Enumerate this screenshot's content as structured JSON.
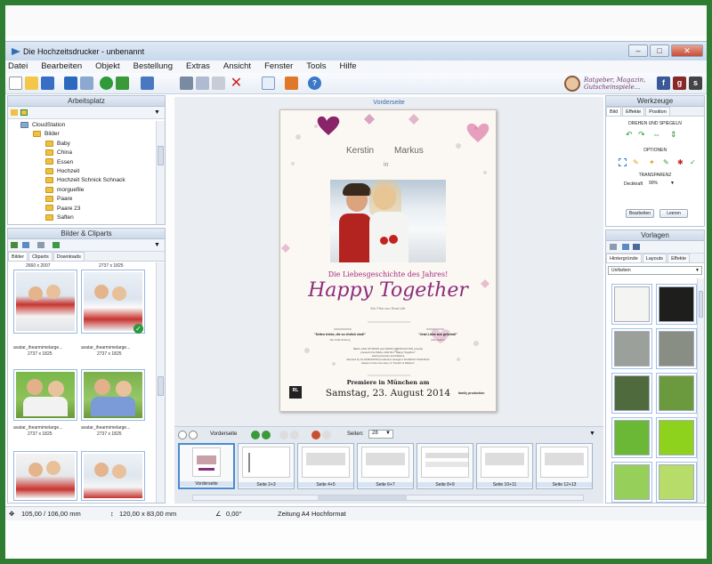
{
  "window": {
    "title": "Die Hochzeitsdrucker - unbenannt"
  },
  "menu": [
    "Datei",
    "Bearbeiten",
    "Objekt",
    "Bestellung",
    "Extras",
    "Ansicht",
    "Fenster",
    "Tools",
    "Hilfe"
  ],
  "brand": {
    "line1": "Ratgeber, Magazin,",
    "line2": "Gutscheinspiele..."
  },
  "workspace": {
    "title": "Arbeitsplatz",
    "tree": [
      "CloudStation",
      "Bilder",
      "Baby",
      "China",
      "Essen",
      "Hochzeit",
      "Hochzeit Schnick Schnack",
      "morguefile",
      "Paare",
      "Paare 23",
      "Saften"
    ]
  },
  "clipart": {
    "title": "Bilder & Cliparts",
    "tabs": [
      "Bilder",
      "Cliparts",
      "Downloads"
    ],
    "thumbs": [
      {
        "top": "2660 x 2007",
        "bottom": "avatar_ihearmimelarge...",
        "dims": "2737 x 1825"
      },
      {
        "top": "2737 x 1825",
        "bottom": "avatar_ihearmimelarge...",
        "dims": "2737 x 1825"
      },
      {
        "bottom": "avatar_ihearmimelarge...",
        "dims": "2737 x 1825"
      },
      {
        "bottom": "avatar_ihearmimelarge...",
        "dims": "2737 x 1825"
      }
    ]
  },
  "canvas": {
    "page_label": "Vorderseite"
  },
  "card": {
    "name1": "Kerstin",
    "name2": "Markus",
    "in": "in",
    "subtitle": "Die Liebesgeschichte des Jahres!",
    "headline": "Happy Together",
    "tagline": "Ein Film von Real Life",
    "quote_left": "\"Selten triebe, die so ehrlich sind!\"",
    "quote_left_src": "Die Kritik Zeitung",
    "quote_right": "\"Jetzt Liebe aus geheimt!\"",
    "quote_right_src": "Das Gefühl",
    "credits1": "REAL LIFE STUDIOS and FAMILY PRODUCTION proudly",
    "credits2": "presents the REAL LIFE film \"Happy Together\"",
    "credits3": "starring Kerstin and Markus",
    "credits4": "directed by ILLUMINATION  production designer SCHNICK SCHNACK",
    "credits5": "based on the true story of \"Kerstin & Markus\"",
    "premiere": "Premiere in München  am",
    "date": "Samstag, 23. August 2014",
    "rl": "RL",
    "family": "family production"
  },
  "pagesbar": {
    "left_label": "Vorderseite",
    "seiten_label": "Seiten:",
    "seiten_value": "28",
    "thumbs": [
      "Vorderseite",
      "Seite 2+3",
      "Seite 4+5",
      "Seite 6+7",
      "Seite 8+9",
      "Seite 10+11",
      "Seite 12+13"
    ]
  },
  "tools": {
    "title": "Werkzeuge",
    "tabs": [
      "Bild",
      "Effekte",
      "Position"
    ],
    "rotate_label": "DREHEN UND SPIEGELN",
    "options_label": "OPTIONEN",
    "transparency_label": "TRANSPARENZ",
    "transparency_field": "Deckkraft",
    "transparency_value": "90%",
    "edit_button": "Bearbeiten",
    "clear_button": "Leeren"
  },
  "templates": {
    "title": "Vorlagen",
    "tabs": [
      "Hintergründe",
      "Layouts",
      "Effekte"
    ],
    "dropdown": "Unifarben",
    "swatches": [
      "#f4f4f2",
      "#1e1f1c",
      "#9ba09a",
      "#888e84",
      "#4f6a3c",
      "#6b9a3e",
      "#6bb836",
      "#8ed21e",
      "#96d05a",
      "#b8dc6a"
    ]
  },
  "status": {
    "position": "105,00 / 106,00 mm",
    "size": "120,00 x 83,00 mm",
    "angle": "0,00°",
    "format": "Zeitung A4 Hochformat"
  }
}
